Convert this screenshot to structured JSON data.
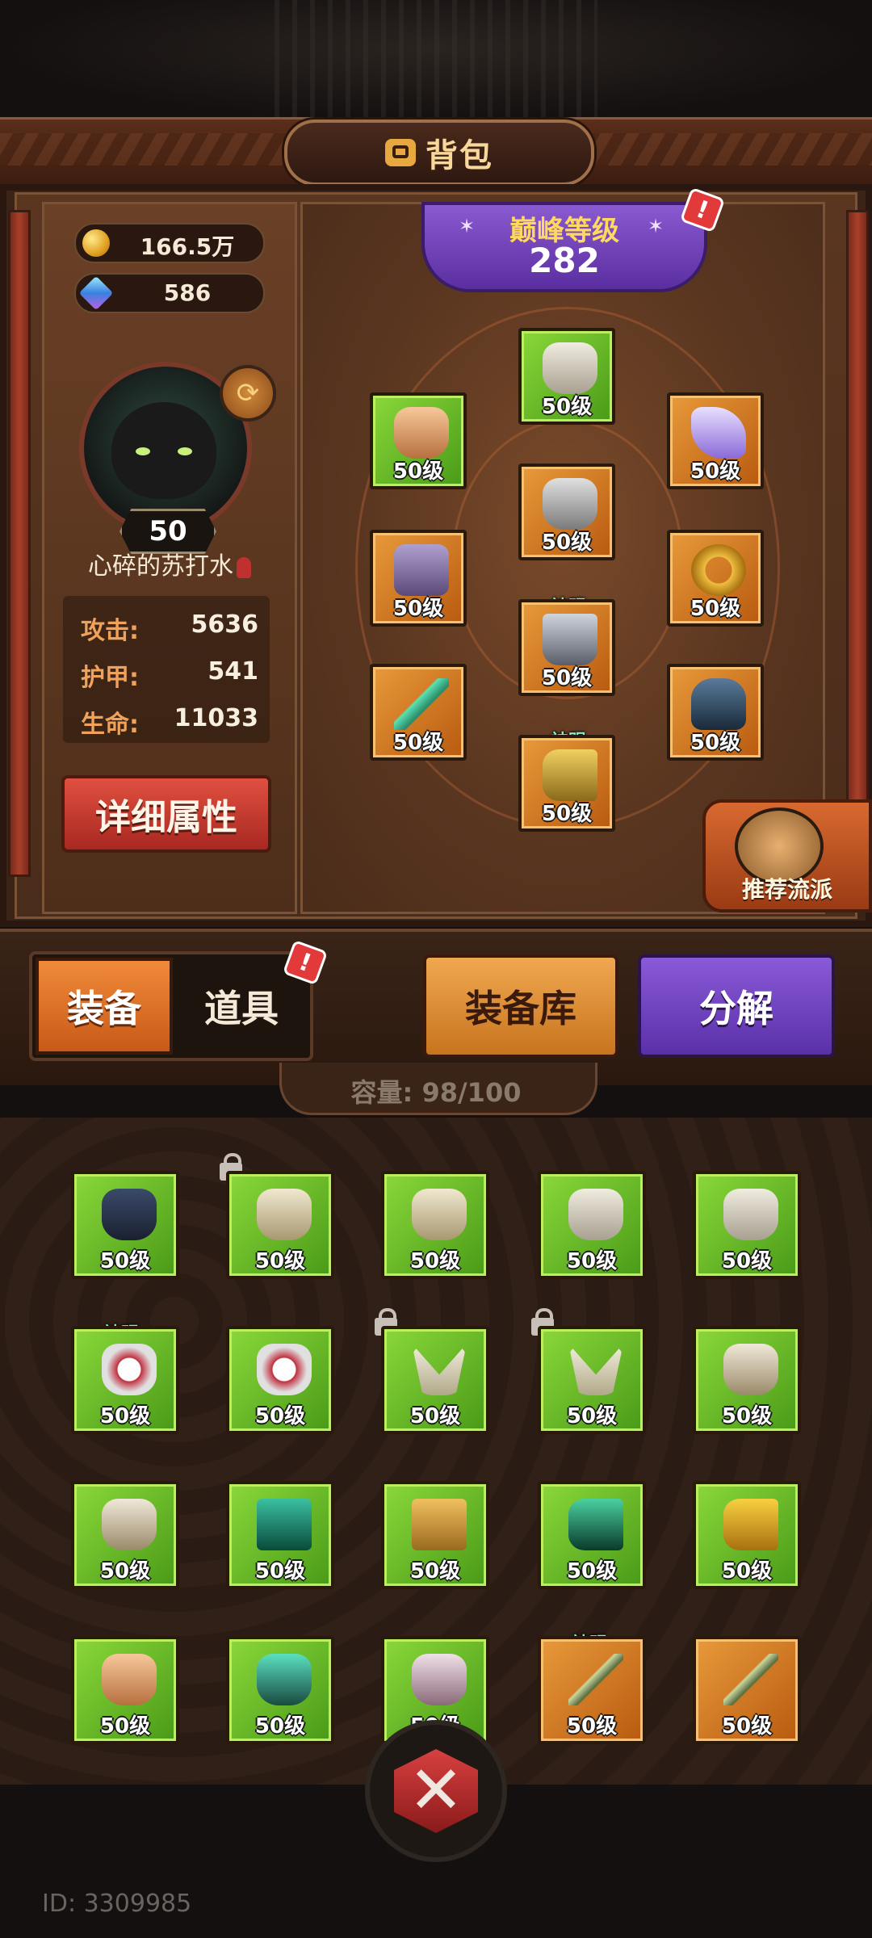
{
  "header": {
    "title": "背包"
  },
  "currency": {
    "gold": "166.5万",
    "gems": "586"
  },
  "player": {
    "level": "50",
    "name": "心碎的苏打水"
  },
  "stats": [
    {
      "label": "攻击:",
      "value": "5636"
    },
    {
      "label": "护甲:",
      "value": "541"
    },
    {
      "label": "生命:",
      "value": "11033"
    }
  ],
  "buttons": {
    "detail": "详细属性",
    "recommend": "推荐流派",
    "warehouse": "装备库",
    "decompose": "分解"
  },
  "peak": {
    "label": "巅峰等级",
    "value": "282"
  },
  "equipped": {
    "level_text": "50级",
    "god_tag": "神赐"
  },
  "tabs": {
    "equip": "装备",
    "items": "道具"
  },
  "capacity": "容量: 98/100",
  "alert_mark": "!",
  "close_glyph": "✕",
  "bag": {
    "level_text": "50级",
    "god_tag": "神赐",
    "rows": [
      [
        "50级",
        "50级",
        "50级",
        "50级",
        "50级"
      ],
      [
        "50级",
        "50级",
        "50级",
        "50级",
        "50级"
      ],
      [
        "50级",
        "50级",
        "50级",
        "50级",
        "50级"
      ],
      [
        "50级",
        "50级",
        "50级",
        "50级",
        "50级"
      ]
    ]
  },
  "footer": {
    "id": "ID: 3309985"
  },
  "colors": {
    "green_slot": "#6ac22a",
    "orange_slot": "#d8802a",
    "accent_purple": "#6a3ab8",
    "alert_red": "#e23a3a"
  }
}
